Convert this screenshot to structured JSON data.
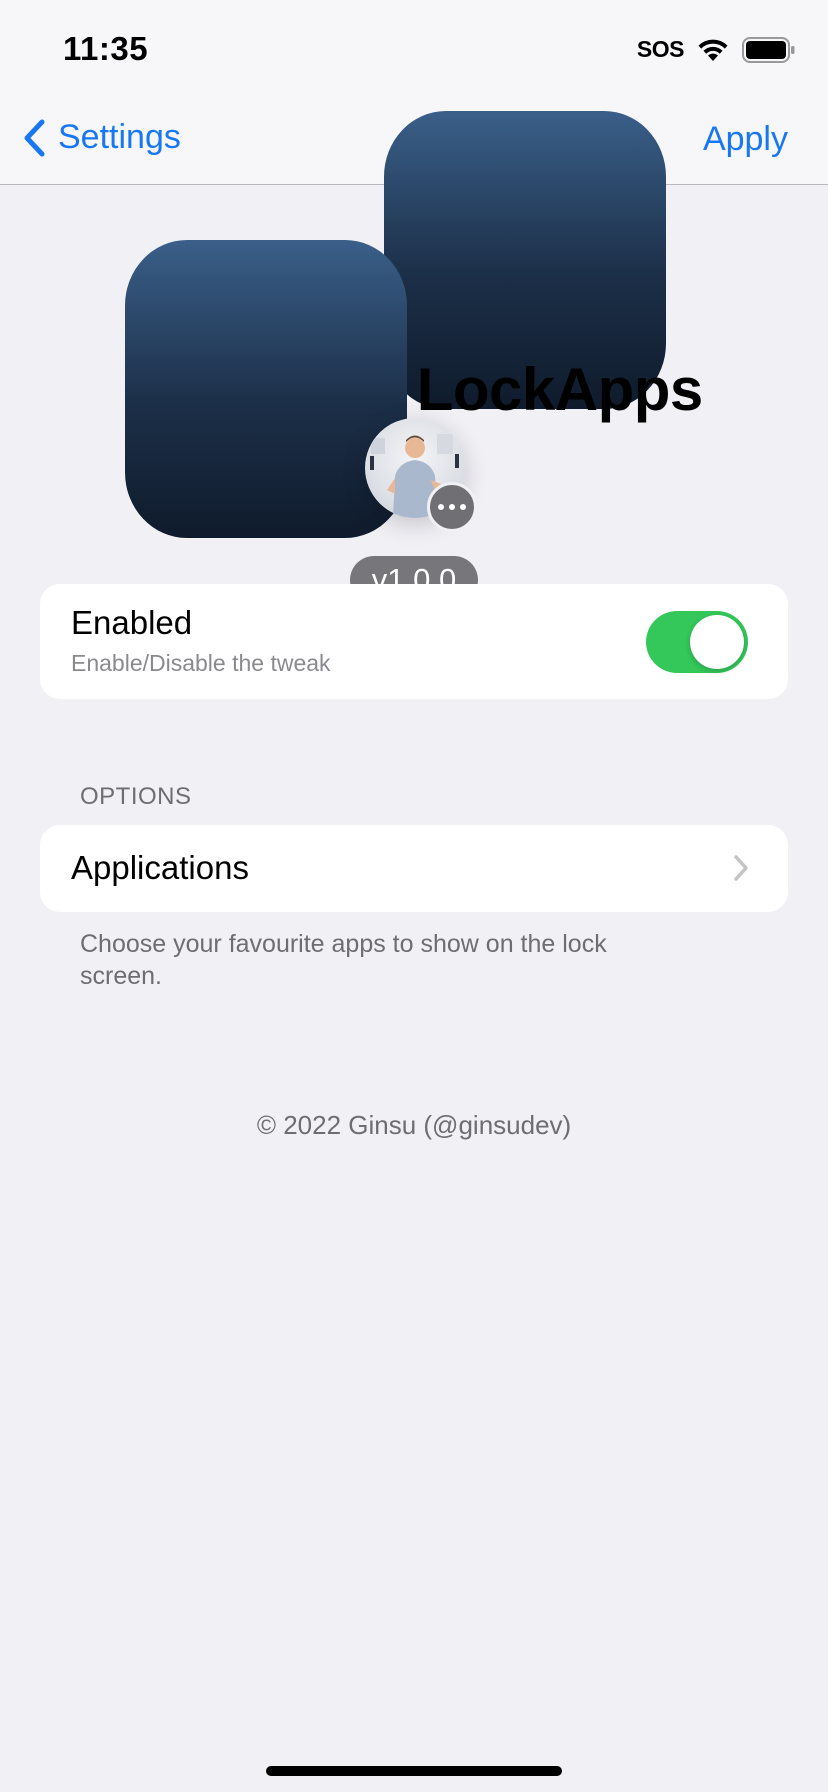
{
  "status_bar": {
    "time": "11:35",
    "sos": "SOS",
    "icons": [
      "wifi-icon",
      "battery-icon"
    ]
  },
  "nav": {
    "back_label": "Settings",
    "apply_label": "Apply",
    "accent_color": "#1878f3"
  },
  "header": {
    "title": "LockApps",
    "version": "v1.0.0"
  },
  "enabled_cell": {
    "title": "Enabled",
    "subtitle": "Enable/Disable the tweak",
    "toggle_on": true,
    "toggle_color": "#34c759"
  },
  "options_section": {
    "header": "OPTIONS",
    "items": [
      {
        "label": "Applications",
        "icon": "chevron-right-icon"
      }
    ],
    "footer": "Choose your favourite apps to show on the lock screen."
  },
  "copyright": "© 2022 Ginsu (@ginsudev)"
}
